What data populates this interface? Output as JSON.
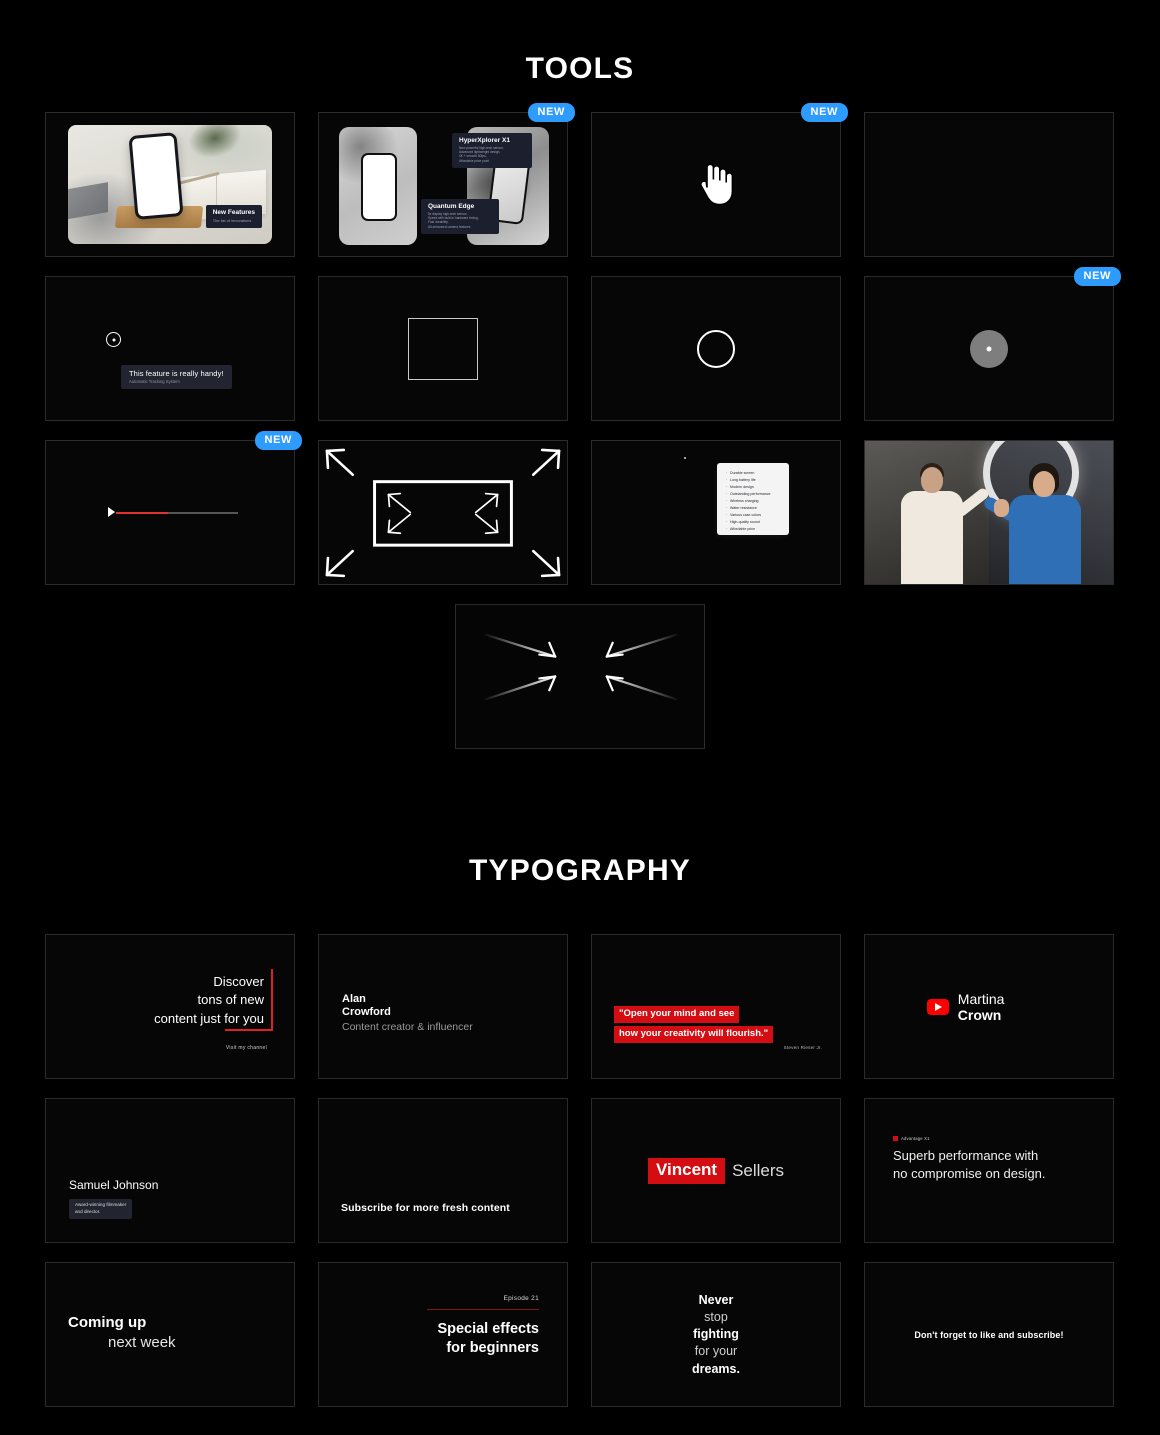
{
  "sections": {
    "tools": {
      "title": "TOOLS",
      "badge_new": "NEW",
      "cards": {
        "product_photo": {
          "label_title": "New Features",
          "label_sub": "The list of innovations"
        },
        "two_phones": {
          "left_title": "Quantum Edge",
          "left_sub": "5x display high-tech sensor,\nSpeed with built-in hardware timing,\nFast durability,\nAll-enhanced camera features",
          "right_title": "HyperXplorer X1",
          "right_sub": "New powerful high-tech sensor,\nAdvanced lightweight design,\n4K + smooth 60fps,\nAffordable price point"
        },
        "tooltip": {
          "title": "This feature is really handy!",
          "sub": "Automatic Tracking System"
        },
        "feature_list": {
          "items": [
            "Durable screen",
            "Long battery life",
            "Modern design",
            "Outstanding performance",
            "Wireless charging",
            "Water resistance",
            "Various case colors",
            "High-quality sound",
            "Affordable price"
          ]
        }
      },
      "badged_cards": [
        "two_phones",
        "hand_cursor",
        "dot_reveal",
        "progress_bar"
      ]
    },
    "typography": {
      "title": "TYPOGRAPHY",
      "cards": {
        "discover": {
          "line1": "Discover",
          "line2": "tons of new",
          "line3": "content just for you",
          "sub": "Visit my channel"
        },
        "alan": {
          "first": "Alan",
          "last": "Crowford",
          "role": "Content creator & influencer"
        },
        "quote": {
          "line1": "\"Open your mind and see",
          "line2": "how your creativity will flourish.\"",
          "author": "Steven Rieser Jr."
        },
        "martina": {
          "first": "Martina ",
          "last": "Crown",
          "icon": "youtube-icon"
        },
        "samuel": {
          "name": "Samuel Johnson",
          "badge_line1": "Award-winning filmmaker",
          "badge_line2": "and director."
        },
        "subscribe": {
          "text": "Subscribe for more fresh content"
        },
        "vincent": {
          "highlight": "Vincent",
          "rest": "Sellers"
        },
        "superb": {
          "tag": "Advantage X1",
          "line1": "Superb performance with",
          "line2": "no compromise on design."
        },
        "coming_up": {
          "line1": "Coming up",
          "line2": "next week"
        },
        "episode": {
          "episode": "Episode 21",
          "line1": "Special effects",
          "line2": "for beginners"
        },
        "never_stop": {
          "l1": "Never",
          "l2": "stop",
          "l3": "fighting",
          "l4": "for your",
          "l5": "dreams."
        },
        "like_subscribe": {
          "text": "Don't forget to like and subscribe!"
        }
      }
    }
  },
  "colors": {
    "background": "#000000",
    "card_border": "#2b2b2b",
    "badge_blue": "#2e9bff",
    "accent_red": "#d40d12",
    "youtube_red": "#ff0000",
    "text_primary": "#ffffff",
    "text_muted": "#9a9a9a"
  }
}
